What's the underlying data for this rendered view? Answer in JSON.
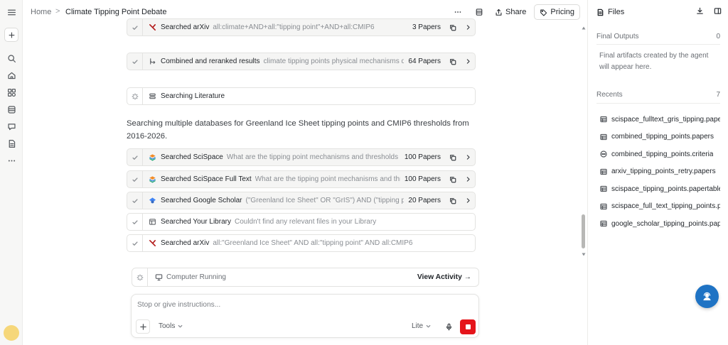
{
  "breadcrumb": {
    "home": "Home",
    "separator": ">",
    "title": "Climate Tipping Point Debate"
  },
  "toolbar": {
    "share_label": "Share",
    "pricing_label": "Pricing"
  },
  "steps_top": [
    {
      "label": "Searched arXiv",
      "query": "all:climate+AND+all:\"tipping point\"+AND+all:CMIP6",
      "count": "3 Papers",
      "icon": "arxiv-icon"
    },
    {
      "label": "Combined and reranked results",
      "query": "climate tipping points physical mechanisms detection thresholds",
      "count": "64 Papers",
      "icon": "merge-icon"
    },
    {
      "label": "Searching Literature",
      "query": "",
      "count": "",
      "icon": "stack-icon"
    }
  ],
  "paragraph": "Searching multiple databases for Greenland Ice Sheet tipping points and CMIP6 thresholds from 2016-2026.",
  "steps_bottom": [
    {
      "label": "Searched SciSpace",
      "query": "What are the tipping point mechanisms and thresholds for the Greenland Ice Sheet",
      "count": "100 Papers",
      "icon": "scispace-icon"
    },
    {
      "label": "Searched SciSpace Full Text",
      "query": "What are the tipping point mechanisms and thresholds for the Greenland Ice Sheet",
      "count": "100 Papers",
      "icon": "scispace-icon"
    },
    {
      "label": "Searched Google Scholar",
      "query": "(\"Greenland Ice Sheet\" OR \"GrIS\") AND (\"tipping point\" OR threshold)",
      "count": "20 Papers",
      "icon": "scholar-icon"
    },
    {
      "label": "Searched Your Library",
      "query": "Couldn't find any relevant files in your Library",
      "count": "",
      "icon": "library-icon"
    },
    {
      "label": "Searched arXiv",
      "query": "all:\"Greenland Ice Sheet\" AND all:\"tipping point\" AND all:CMIP6",
      "count": "",
      "icon": "arxiv-icon"
    }
  ],
  "running": {
    "label": "Computer Running",
    "view_activity": "View Activity →"
  },
  "composer": {
    "placeholder": "Stop or give instructions...",
    "tools_label": "Tools",
    "mode_label": "Lite"
  },
  "files_panel": {
    "title": "Files",
    "final_outputs_label": "Final Outputs",
    "final_outputs_count": "0",
    "final_outputs_desc": "Final artifacts created by the agent will appear here.",
    "recents_label": "Recents",
    "recents_count": "7",
    "recents": [
      {
        "name": "scispace_fulltext_gris_tipping.papers",
        "icon": "table-icon"
      },
      {
        "name": "combined_tipping_points.papers",
        "icon": "table-icon"
      },
      {
        "name": "combined_tipping_points.criteria",
        "icon": "dots-circle-icon"
      },
      {
        "name": "arxiv_tipping_points_retry.papers",
        "icon": "table-icon"
      },
      {
        "name": "scispace_tipping_points.papertable",
        "icon": "table-icon"
      },
      {
        "name": "scispace_full_text_tipping_points.papers",
        "icon": "table-icon"
      },
      {
        "name": "google_scholar_tipping_points.papers",
        "icon": "table-icon"
      }
    ]
  },
  "colors": {
    "stop_red": "#e5151b",
    "help_blue": "#1f73c4",
    "arxiv_red": "#b31b1b"
  }
}
